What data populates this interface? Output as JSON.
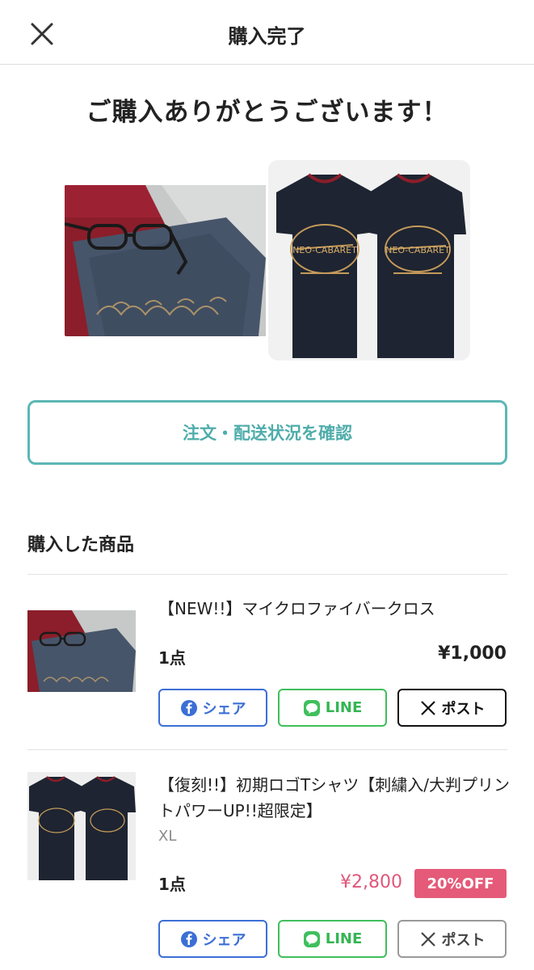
{
  "header": {
    "title": "購入完了",
    "close_icon": "close-icon"
  },
  "main": {
    "thanks_message": "ご購入ありがとうございます！",
    "order_status_button": "注文・配送状況を確認"
  },
  "purchased": {
    "section_title": "購入した商品",
    "items": [
      {
        "name": "【NEW!!】マイクロファイバークロス",
        "variant": "",
        "quantity": "1点",
        "price": "¥1,000",
        "discount": ""
      },
      {
        "name": "【復刻!!】初期ロゴTシャツ【刺繍入/大判プリントパワーUP!!超限定】",
        "variant": "XL",
        "quantity": "1点",
        "price": "¥2,800",
        "discount": "20%OFF"
      }
    ]
  },
  "share": {
    "facebook": "シェア",
    "line": "LINE",
    "x": "ポスト"
  },
  "colors": {
    "accent": "#5bb7b5",
    "sale": "#e0577a",
    "facebook": "#3b6fd6",
    "line": "#3fbf5c"
  }
}
